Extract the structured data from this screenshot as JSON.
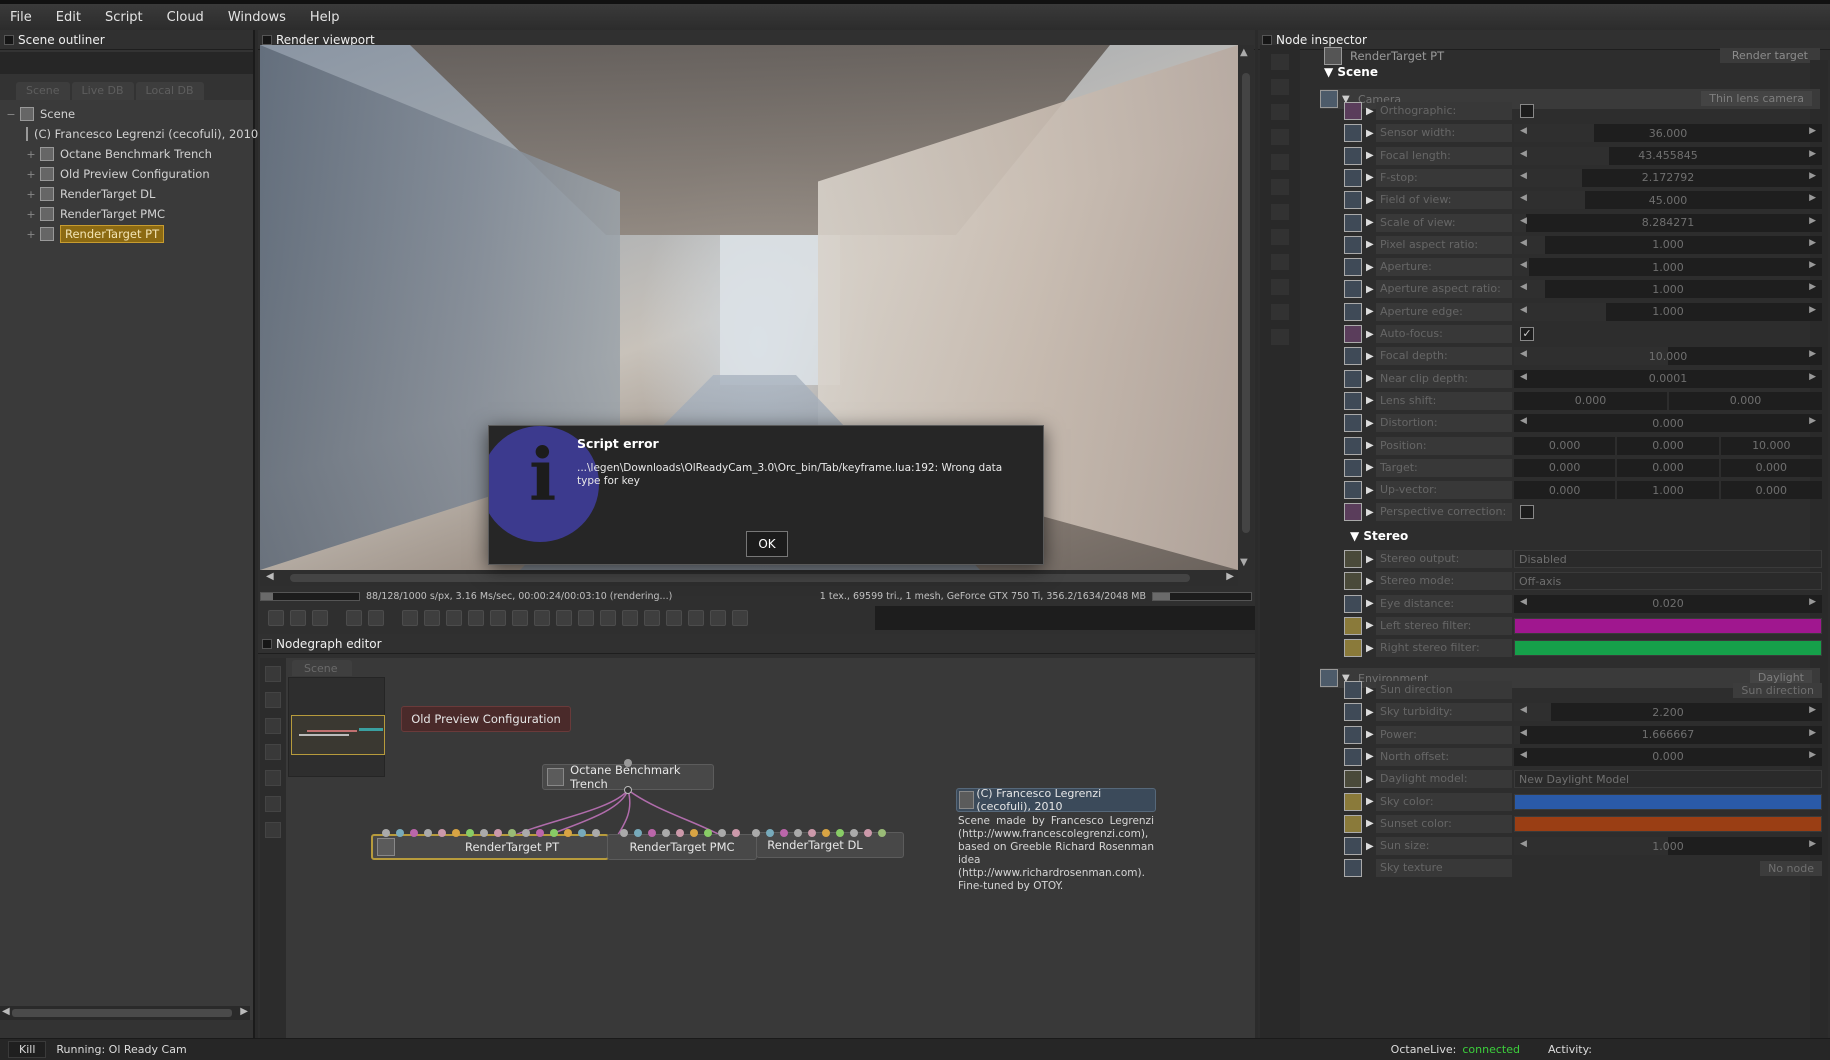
{
  "menubar": {
    "items": [
      "File",
      "Edit",
      "Script",
      "Cloud",
      "Windows",
      "Help"
    ]
  },
  "outliner": {
    "title": "Scene outliner",
    "tabs": [
      "Scene",
      "Live DB",
      "Local DB"
    ],
    "tree": [
      {
        "label": "Scene",
        "icon": "scene-icon",
        "expanded": true,
        "selected": false
      },
      {
        "label": "(C) Francesco Legrenzi (cecofuli), 2010",
        "icon": "comment-icon",
        "selected": false
      },
      {
        "label": "Octane Benchmark Trench",
        "icon": "mesh-icon",
        "selected": false
      },
      {
        "label": "Old Preview Configuration",
        "icon": "scene-icon",
        "selected": false
      },
      {
        "label": "RenderTarget DL",
        "icon": "render-target-icon",
        "selected": false
      },
      {
        "label": "RenderTarget PMC",
        "icon": "render-target-icon",
        "selected": false
      },
      {
        "label": "RenderTarget PT",
        "icon": "render-target-icon",
        "selected": true
      }
    ]
  },
  "viewport": {
    "title": "Render viewport",
    "status_left": "88/128/1000 s/px, 3.16 Ms/sec, 00:00:24/00:03:10 (rendering...)",
    "status_right": "1 tex., 69599 tri., 1 mesh, GeForce GTX 750 Ti, 356.2/1634/2048 MB",
    "progress": 0.12,
    "memory_usage": 0.17
  },
  "dialog": {
    "title": "Script error",
    "message": "...\\legen\\Downloads\\OlReadyCam_3.0\\Orc_bin/Tab/keyframe.lua:192: Wrong data type for key",
    "ok_label": "OK",
    "icon": "info-icon"
  },
  "nodegraph": {
    "title": "Nodegraph editor",
    "tab": "Scene",
    "nodes": {
      "preview": "Old Preview Configuration",
      "benchmark": "Octane Benchmark Trench",
      "rt_pt": "RenderTarget PT",
      "rt_pmc": "RenderTarget PMC",
      "rt_dl": "RenderTarget DL",
      "comment_title": "(C) Francesco Legrenzi (cecofuli), 2010",
      "comment_body": "Scene made by Francesco Legrenzi (http://www.francescolegrenzi.com), based on Greeble Richard Rosenman idea (http://www.richardrosenman.com). Fine-tuned by OTOY."
    }
  },
  "inspector": {
    "title": "Node inspector",
    "header": "RenderTarget PT",
    "header_right": "Render target",
    "scene_label": "Scene",
    "camera": {
      "label": "Camera",
      "type": "Thin lens camera"
    },
    "camera_rows": [
      {
        "label": "Orthographic:",
        "kind": "bool",
        "checked": false
      },
      {
        "label": "Sensor width:",
        "kind": "float",
        "value": "36.000",
        "level": 0.26
      },
      {
        "label": "Focal length:",
        "kind": "float",
        "value": "43.455845",
        "level": 0.31
      },
      {
        "label": "F-stop:",
        "kind": "float",
        "value": "2.172792",
        "level": 0.22
      },
      {
        "label": "Field of view:",
        "kind": "float",
        "value": "45.000",
        "level": 0.23
      },
      {
        "label": "Scale of view:",
        "kind": "float",
        "value": "8.284271",
        "level": 0.04
      },
      {
        "label": "Pixel aspect ratio:",
        "kind": "float",
        "value": "1.000",
        "level": 0.1
      },
      {
        "label": "Aperture:",
        "kind": "float",
        "value": "1.000",
        "level": 0.05
      },
      {
        "label": "Aperture aspect ratio:",
        "kind": "float",
        "value": "1.000",
        "level": 0.1
      },
      {
        "label": "Aperture edge:",
        "kind": "float",
        "value": "1.000",
        "level": 0.3
      },
      {
        "label": "Auto-focus:",
        "kind": "bool",
        "checked": true
      },
      {
        "label": "Focal depth:",
        "kind": "float",
        "value": "10.000",
        "level": 0.5
      },
      {
        "label": "Near clip depth:",
        "kind": "float",
        "value": "0.0001",
        "level": 0.0
      },
      {
        "label": "Lens shift:",
        "kind": "vec2",
        "values": [
          "0.000",
          "0.000"
        ]
      },
      {
        "label": "Distortion:",
        "kind": "float",
        "value": "0.000",
        "level": 0.0
      },
      {
        "label": "Position:",
        "kind": "vec3",
        "values": [
          "0.000",
          "0.000",
          "10.000"
        ]
      },
      {
        "label": "Target:",
        "kind": "vec3",
        "values": [
          "0.000",
          "0.000",
          "0.000"
        ]
      },
      {
        "label": "Up-vector:",
        "kind": "vec3",
        "values": [
          "0.000",
          "1.000",
          "0.000"
        ]
      },
      {
        "label": "Perspective correction:",
        "kind": "bool",
        "checked": false
      }
    ],
    "stereo_label": "Stereo",
    "stereo_rows": [
      {
        "label": "Stereo output:",
        "kind": "enum",
        "value": "Disabled"
      },
      {
        "label": "Stereo mode:",
        "kind": "enum",
        "value": "Off-axis"
      },
      {
        "label": "Eye distance:",
        "kind": "float",
        "value": "0.020",
        "level": 0.0
      },
      {
        "label": "Left stereo filter:",
        "kind": "color",
        "color": "#a0178f"
      },
      {
        "label": "Right stereo filter:",
        "kind": "color",
        "color": "#16a04a"
      }
    ],
    "environment": {
      "label": "Environment",
      "type": "Daylight"
    },
    "env_rows": [
      {
        "label": "Sun direction",
        "kind": "button",
        "value": "Sun direction"
      },
      {
        "label": "Sky turbidity:",
        "kind": "float",
        "value": "2.200",
        "level": 0.12
      },
      {
        "label": "Power:",
        "kind": "float",
        "value": "1.666667",
        "level": 0.02
      },
      {
        "label": "North offset:",
        "kind": "float",
        "value": "0.000",
        "level": 0.0
      },
      {
        "label": "Daylight model:",
        "kind": "enum",
        "value": "New Daylight Model"
      },
      {
        "label": "Sky color:",
        "kind": "color",
        "color": "#2a5aa8"
      },
      {
        "label": "Sunset color:",
        "kind": "color",
        "color": "#9a3e14"
      },
      {
        "label": "Sun size:",
        "kind": "float",
        "value": "1.000",
        "level": 0.5
      },
      {
        "label": "Sky texture",
        "kind": "node",
        "value": "No node"
      }
    ]
  },
  "statusbar": {
    "kill_label": "Kill",
    "running": "Running: Ol Ready Cam",
    "octanelive_label": "OctaneLive:",
    "octanelive_status": "connected",
    "activity_label": "Activity:"
  }
}
